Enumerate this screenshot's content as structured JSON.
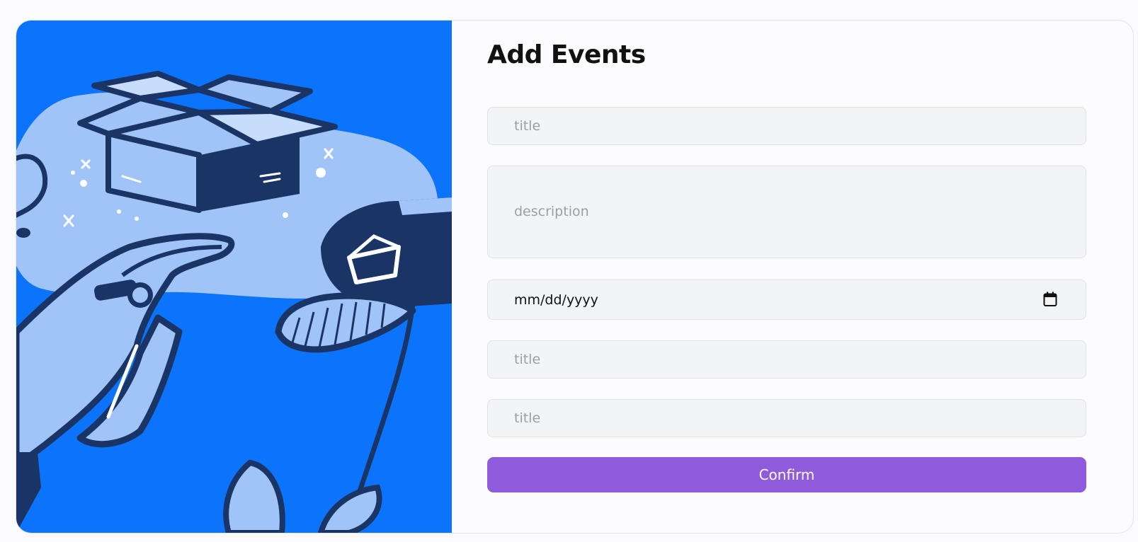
{
  "form": {
    "heading": "Add Events",
    "fields": {
      "title_1": {
        "placeholder": "title",
        "value": ""
      },
      "description": {
        "placeholder": "description",
        "value": ""
      },
      "date": {
        "display": "mm/dd/yyyy",
        "icon": "calendar-icon"
      },
      "title_2": {
        "placeholder": "title",
        "value": ""
      },
      "title_3": {
        "placeholder": "title",
        "value": ""
      }
    },
    "confirm_label": "Confirm"
  },
  "colors": {
    "illustration_bg": "#0b74fb",
    "illustration_dark": "#1a3565",
    "illustration_light": "#a0c4f8",
    "button_bg": "#8f5bdc"
  }
}
